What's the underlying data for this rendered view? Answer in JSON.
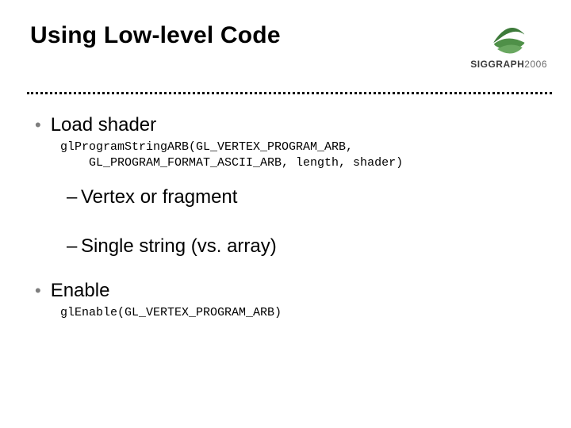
{
  "title": "Using Low-level Code",
  "brand": {
    "name": "SIGGRAPH",
    "year": "2006"
  },
  "bullets": {
    "item1": {
      "label": "Load shader",
      "code_line1": "glProgramStringARB(GL_VERTEX_PROGRAM_ARB,",
      "code_line2": "    GL_PROGRAM_FORMAT_ASCII_ARB, length, shader)",
      "sub1": "Vertex or fragment",
      "sub2": "Single string (vs. array)"
    },
    "item2": {
      "label": "Enable",
      "code_line1": "glEnable(GL_VERTEX_PROGRAM_ARB)"
    }
  }
}
